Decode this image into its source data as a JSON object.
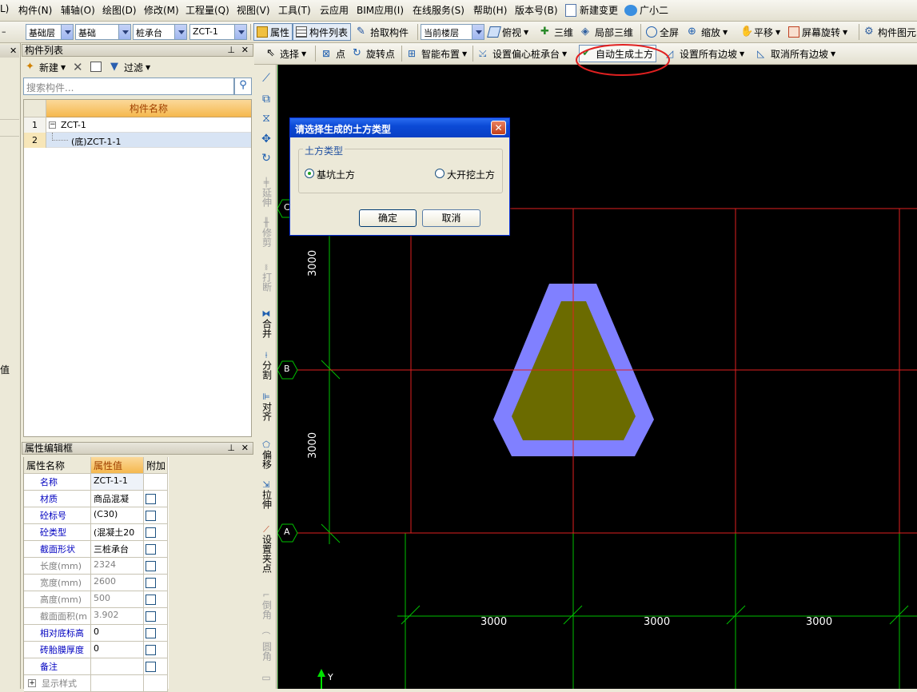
{
  "menu": [
    "L)",
    "构件(N)",
    "辅轴(O)",
    "绘图(D)",
    "修改(M)",
    "工程量(Q)",
    "视图(V)",
    "工具(T)",
    "云应用",
    "BIM应用(I)",
    "在线服务(S)",
    "帮助(H)",
    "版本号(B)",
    "新建变更",
    "广小二"
  ],
  "toolbar1": {
    "layer_select": "基础层",
    "category_select": "基础",
    "type_select": "桩承台",
    "component_select": "ZCT-1",
    "btn_property": "属性",
    "btn_component_list": "构件列表",
    "btn_pick": "拾取构件",
    "floor_select": "当前楼层",
    "btn_topview": "俯视",
    "btn_3d": "三维",
    "btn_local3d": "局部三维",
    "btn_fullscreen": "全屏",
    "btn_zoom": "缩放",
    "btn_pan": "平移",
    "btn_rotate_screen": "屏幕旋转",
    "btn_component_outline": "构件图元"
  },
  "toolbar2": {
    "select": "选择",
    "point": "点",
    "rotate_point": "旋转点",
    "smart_layout": "智能布置",
    "set_offset_cap": "设置偏心桩承台",
    "auto_earthwork": "自动生成土方",
    "set_all_slopes": "设置所有边坡",
    "cancel_all_slopes": "取消所有边坡"
  },
  "component_panel": {
    "title": "构件列表",
    "new_btn": "新建",
    "filter_btn": "过滤",
    "search_placeholder": "搜索构件...",
    "header": "构件名称",
    "rows": [
      {
        "num": "1",
        "name": "ZCT-1"
      },
      {
        "num": "2",
        "name": "(底)ZCT-1-1"
      }
    ]
  },
  "left_edge_char": "值",
  "property_panel": {
    "title": "属性编辑框",
    "headers": [
      "属性名称",
      "属性值",
      "附加"
    ],
    "rows": [
      {
        "name": "名称",
        "value": "ZCT-1-1",
        "blue": true,
        "has_check": false
      },
      {
        "name": "材质",
        "value": "商品混凝",
        "blue": true,
        "has_check": true
      },
      {
        "name": "砼标号",
        "value": "(C30)",
        "blue": true,
        "has_check": true
      },
      {
        "name": "砼类型",
        "value": "(混凝土20",
        "blue": true,
        "has_check": true
      },
      {
        "name": "截面形状",
        "value": "三桩承台",
        "blue": true,
        "has_check": true
      },
      {
        "name": "长度(mm)",
        "value": "2324",
        "blue": false,
        "has_check": true
      },
      {
        "name": "宽度(mm)",
        "value": "2600",
        "blue": false,
        "has_check": true
      },
      {
        "name": "高度(mm)",
        "value": "500",
        "blue": false,
        "has_check": true
      },
      {
        "name": "截面面积(m",
        "value": "3.902",
        "blue": false,
        "has_check": true
      },
      {
        "name": "相对底标高",
        "value": "0",
        "blue": true,
        "has_check": true
      },
      {
        "name": "砖胎膜厚度",
        "value": "0",
        "blue": true,
        "has_check": true
      },
      {
        "name": "备注",
        "value": "",
        "blue": true,
        "has_check": true
      },
      {
        "name": "显示样式",
        "value": "",
        "blue": false,
        "has_check": false
      }
    ]
  },
  "vertical_tools": [
    "延伸",
    "修剪",
    "打断",
    "合并",
    "分割",
    "对齐",
    "偏移",
    "拉伸",
    "设置夹点",
    "倒角",
    "圆角"
  ],
  "cad": {
    "axis_labels": [
      "C",
      "B",
      "A"
    ],
    "dim_vertical": [
      "3000",
      "3000"
    ],
    "dim_horizontal": [
      "3000",
      "3000",
      "3000"
    ],
    "y_label": "Y",
    "outer_color": "#8080ff",
    "inner_color": "#6b6b00"
  },
  "dialog": {
    "title": "请选择生成的土方类型",
    "group_label": "土方类型",
    "option1": "基坑土方",
    "option2": "大开挖土方",
    "selected": "基坑土方",
    "ok": "确定",
    "cancel": "取消"
  }
}
